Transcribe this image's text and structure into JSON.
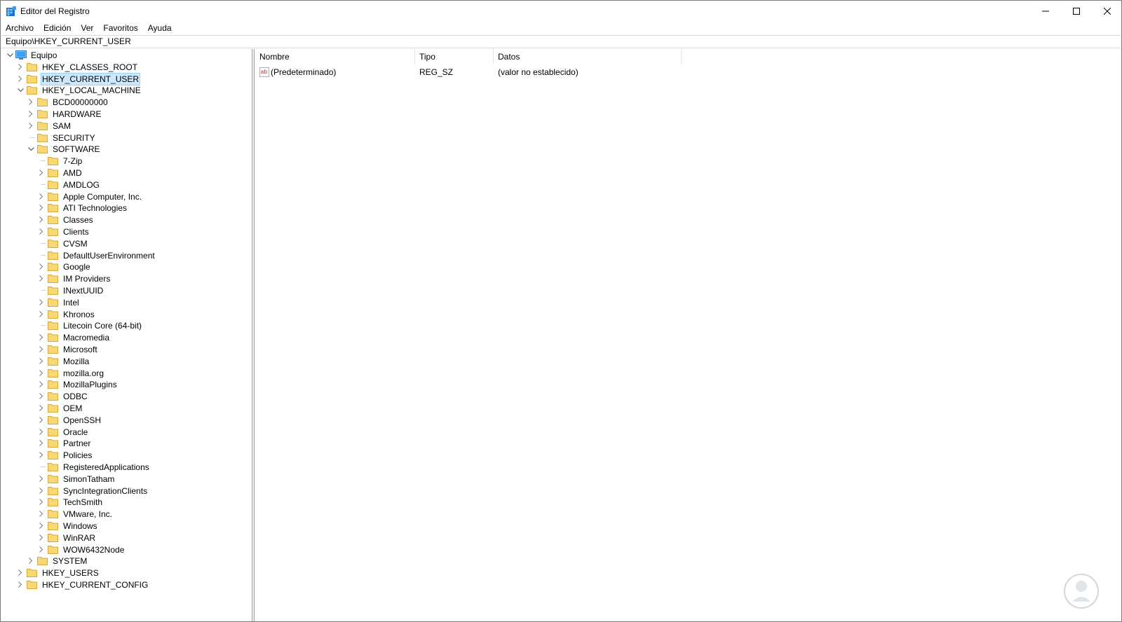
{
  "window": {
    "title": "Editor del Registro",
    "icon": "regedit-icon"
  },
  "menu": [
    "Archivo",
    "Edición",
    "Ver",
    "Favoritos",
    "Ayuda"
  ],
  "address": "Equipo\\HKEY_CURRENT_USER",
  "tree": {
    "root": "Equipo",
    "hives": [
      {
        "label": "HKEY_CLASSES_ROOT",
        "expandable": true,
        "expanded": false
      },
      {
        "label": "HKEY_CURRENT_USER",
        "expandable": true,
        "expanded": false,
        "selected": true
      },
      {
        "label": "HKEY_LOCAL_MACHINE",
        "expandable": true,
        "expanded": true
      },
      {
        "label": "HKEY_USERS",
        "expandable": true,
        "expanded": false
      },
      {
        "label": "HKEY_CURRENT_CONFIG",
        "expandable": true,
        "expanded": false
      }
    ],
    "hklm_children": [
      {
        "label": "BCD00000000",
        "expandable": true
      },
      {
        "label": "HARDWARE",
        "expandable": true
      },
      {
        "label": "SAM",
        "expandable": true
      },
      {
        "label": "SECURITY",
        "expandable": false
      },
      {
        "label": "SOFTWARE",
        "expandable": true,
        "expanded": true
      },
      {
        "label": "SYSTEM",
        "expandable": true
      }
    ],
    "software_children": [
      {
        "label": "7-Zip",
        "expandable": false
      },
      {
        "label": "AMD",
        "expandable": true
      },
      {
        "label": "AMDLOG",
        "expandable": false
      },
      {
        "label": "Apple Computer, Inc.",
        "expandable": true
      },
      {
        "label": "ATI Technologies",
        "expandable": true
      },
      {
        "label": "Classes",
        "expandable": true
      },
      {
        "label": "Clients",
        "expandable": true
      },
      {
        "label": "CVSM",
        "expandable": false
      },
      {
        "label": "DefaultUserEnvironment",
        "expandable": false
      },
      {
        "label": "Google",
        "expandable": true
      },
      {
        "label": "IM Providers",
        "expandable": true
      },
      {
        "label": "INextUUID",
        "expandable": false
      },
      {
        "label": "Intel",
        "expandable": true
      },
      {
        "label": "Khronos",
        "expandable": true
      },
      {
        "label": "Litecoin Core (64-bit)",
        "expandable": false
      },
      {
        "label": "Macromedia",
        "expandable": true
      },
      {
        "label": "Microsoft",
        "expandable": true
      },
      {
        "label": "Mozilla",
        "expandable": true
      },
      {
        "label": "mozilla.org",
        "expandable": true
      },
      {
        "label": "MozillaPlugins",
        "expandable": true
      },
      {
        "label": "ODBC",
        "expandable": true
      },
      {
        "label": "OEM",
        "expandable": true
      },
      {
        "label": "OpenSSH",
        "expandable": true
      },
      {
        "label": "Oracle",
        "expandable": true
      },
      {
        "label": "Partner",
        "expandable": true
      },
      {
        "label": "Policies",
        "expandable": true
      },
      {
        "label": "RegisteredApplications",
        "expandable": false
      },
      {
        "label": "SimonTatham",
        "expandable": true
      },
      {
        "label": "SyncIntegrationClients",
        "expandable": true
      },
      {
        "label": "TechSmith",
        "expandable": true
      },
      {
        "label": "VMware, Inc.",
        "expandable": true
      },
      {
        "label": "Windows",
        "expandable": true
      },
      {
        "label": "WinRAR",
        "expandable": true
      },
      {
        "label": "WOW6432Node",
        "expandable": true
      }
    ]
  },
  "list": {
    "columns": [
      "Nombre",
      "Tipo",
      "Datos"
    ],
    "rows": [
      {
        "name": "(Predeterminado)",
        "type": "REG_SZ",
        "data": "(valor no establecido)",
        "icon": "string-value-icon"
      }
    ]
  },
  "colors": {
    "selection_bg": "#cce8ff",
    "selection_border": "#99d1ff",
    "folder": "#f8d775",
    "accent": "#0078d7"
  }
}
